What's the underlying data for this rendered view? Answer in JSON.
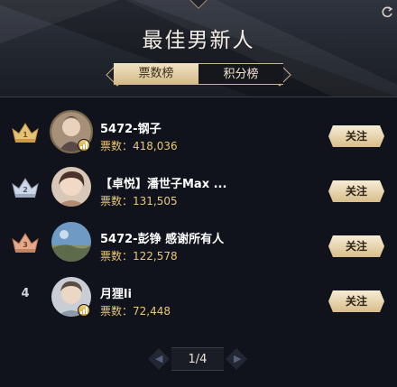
{
  "title": "最佳男新人",
  "tabs": [
    {
      "label": "票数榜",
      "active": true
    },
    {
      "label": "积分榜",
      "active": false
    }
  ],
  "votes_label": "票数：",
  "follow_label": "关注",
  "entries": [
    {
      "rank": "1",
      "name": "5472-钢子",
      "votes": "418,036"
    },
    {
      "rank": "2",
      "name": "【卓悦】潘世子Max ...",
      "votes": "131,505"
    },
    {
      "rank": "3",
      "name": "5472-彭铮 感谢所有人",
      "votes": "122,578"
    },
    {
      "rank": "4",
      "name": "月狸li",
      "votes": "72,448"
    }
  ],
  "pagination": {
    "text": "1/4",
    "prev_icon": "chevron-left-icon",
    "next_icon": "chevron-right-icon"
  },
  "colors": {
    "gold": "#e7c877",
    "button_light": "#f6ecd6",
    "button_dark": "#d8bd8a",
    "background": "#10131c",
    "crown_gold": "#e5c27a",
    "crown_silver": "#cdd6e6",
    "crown_bronze": "#e3a98a"
  }
}
